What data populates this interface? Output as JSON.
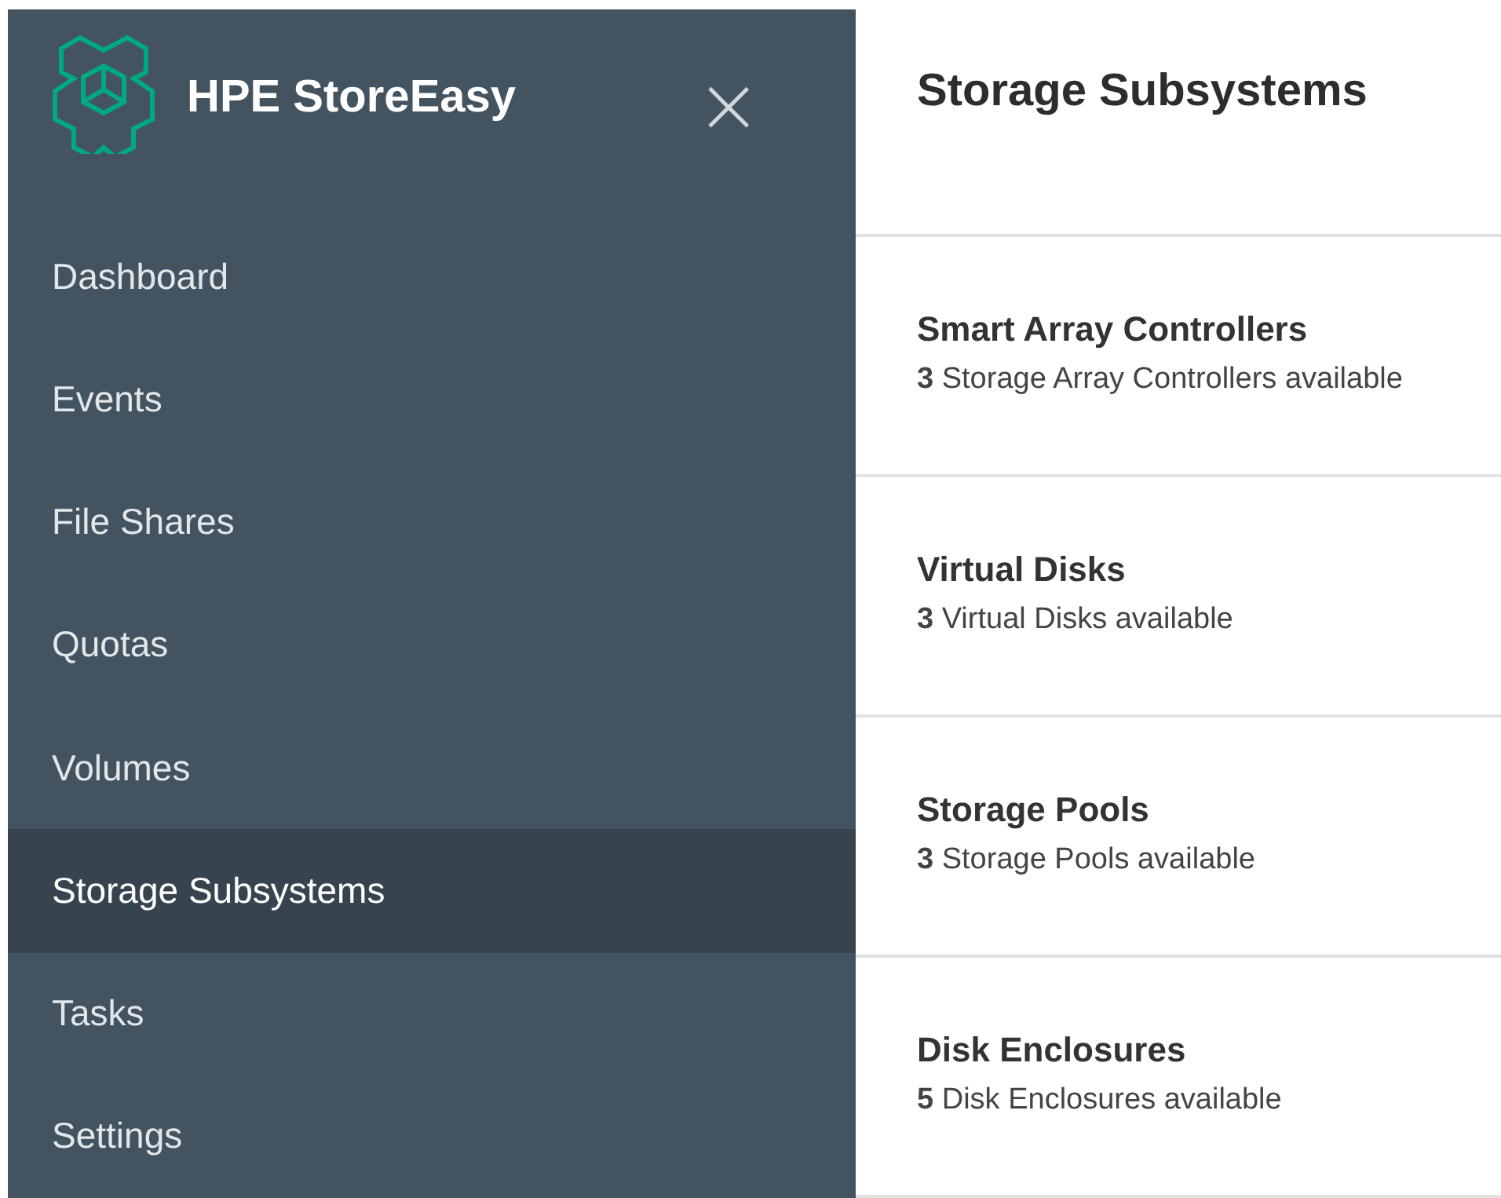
{
  "sidebar": {
    "brand": "HPE StoreEasy",
    "close": "×",
    "items": [
      {
        "label": "Dashboard",
        "selected": false
      },
      {
        "label": "Events",
        "selected": false
      },
      {
        "label": "File Shares",
        "selected": false
      },
      {
        "label": "Quotas",
        "selected": false
      },
      {
        "label": "Volumes",
        "selected": false
      },
      {
        "label": "Storage Subsystems",
        "selected": true
      },
      {
        "label": "Tasks",
        "selected": false
      },
      {
        "label": "Settings",
        "selected": false
      }
    ]
  },
  "main": {
    "title": "Storage Subsystems",
    "cards": [
      {
        "title": "Smart Array Controllers",
        "summary": "**3** Storage Array Controllers available"
      },
      {
        "title": "Virtual Disks",
        "summary": "**3** Virtual Disks available"
      },
      {
        "title": "Storage Pools",
        "summary": "**3** Storage Pools available"
      },
      {
        "title": "Disk Enclosures",
        "summary": "**5** Disk Enclosures available"
      }
    ]
  }
}
